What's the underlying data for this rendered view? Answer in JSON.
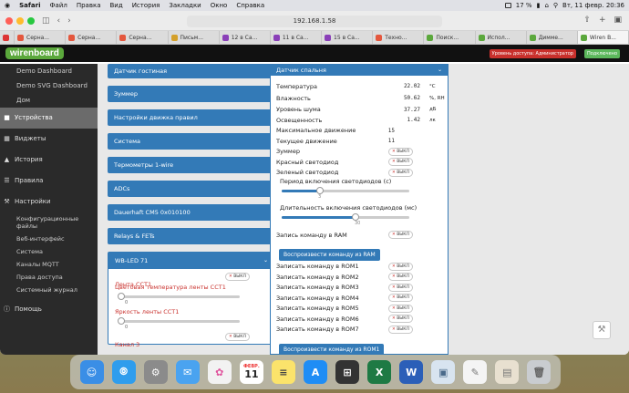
{
  "menubar": {
    "apple": "",
    "app": "Safari",
    "items": [
      "Файл",
      "Правка",
      "Вид",
      "История",
      "Закладки",
      "Окно",
      "Справка"
    ],
    "battery": "17 %",
    "datetime": "Вт, 11 февр. 20:36"
  },
  "browser": {
    "url": "192.168.1.58",
    "tabs": [
      "Серна...",
      "Серна...",
      "Серна...",
      "Письм...",
      "12 в Са...",
      "11 в Са...",
      "15 в Са...",
      "Техно...",
      "Поиск...",
      "Испол...",
      "Димме...",
      "Wiren B..."
    ]
  },
  "header": {
    "logo": "wirenboard",
    "access": "Уровень доступа: Администратор",
    "connected": "Подключено"
  },
  "sidebar": {
    "top_items": [
      "Demo Dashboard",
      "Demo SVG Dashboard",
      "Дом"
    ],
    "devices": "Устройства",
    "widgets": "Виджеты",
    "history": "История",
    "rules": "Правила",
    "settings": "Настройки",
    "settings_items": [
      "Конфигурационные файлы",
      "Веб-интерфейс",
      "Система",
      "Каналы MQTT",
      "Права доступа",
      "Системный журнал"
    ],
    "help": "Помощь"
  },
  "col1": {
    "panels": [
      "Датчик гостиная",
      "Зуммер",
      "Настройки движка правил",
      "Система",
      "Термометры 1-wire",
      "ADCs",
      "Dauerhaft CM5 0x010100",
      "Relays & FETs"
    ],
    "open_panel": {
      "title": "WB-LED 71",
      "items": [
        {
          "type": "switch",
          "label": "Лента CCT1",
          "value": "ВЫКЛ"
        },
        {
          "type": "slider",
          "label": "Цветовая температура ленты CCT1",
          "value": "0",
          "fraction": 0
        },
        {
          "type": "slider",
          "label": "Яркость ленты CCT1",
          "value": "0",
          "fraction": 0
        },
        {
          "type": "switch",
          "label": "Канал 3",
          "value": "ВЫКЛ"
        }
      ]
    }
  },
  "col2": {
    "title": "Датчик спальня",
    "readings": [
      {
        "name": "Температура",
        "value": "22.02",
        "unit": "°C"
      },
      {
        "name": "Влажность",
        "value": "50.62",
        "unit": "%, RH"
      },
      {
        "name": "Уровень шума",
        "value": "37.27",
        "unit": "дБ"
      },
      {
        "name": "Освещенность",
        "value": "1.42",
        "unit": "лк"
      },
      {
        "name": "Максимальное движение",
        "value": "15",
        "unit": ""
      },
      {
        "name": "Текущее движение",
        "value": "11",
        "unit": ""
      }
    ],
    "switches": [
      {
        "name": "Зуммер",
        "value": "ВЫКЛ"
      },
      {
        "name": "Красный светодиод",
        "value": "ВЫКЛ"
      },
      {
        "name": "Зеленый светодиод",
        "value": "ВЫКЛ"
      }
    ],
    "led_period": {
      "label": "Период включения светодиодов (с)",
      "value": "3",
      "fraction": 0.3
    },
    "led_duration": {
      "label": "Длительность включения светодиодов (мс)",
      "value": "30",
      "fraction": 0.58
    },
    "ram": {
      "label": "Запись команду в RAM",
      "value": "ВЫКЛ",
      "button": "Воспроизвести команду из RAM"
    },
    "rom": [
      {
        "name": "Записать команду в ROM1",
        "value": "ВЫКЛ"
      },
      {
        "name": "Записать команду в ROM2",
        "value": "ВЫКЛ"
      },
      {
        "name": "Записать команду в ROM3",
        "value": "ВЫКЛ"
      },
      {
        "name": "Записать команду в ROM4",
        "value": "ВЫКЛ"
      },
      {
        "name": "Записать команду в ROM5",
        "value": "ВЫКЛ"
      },
      {
        "name": "Записать команду в ROM6",
        "value": "ВЫКЛ"
      },
      {
        "name": "Записать команду в ROM7",
        "value": "ВЫКЛ"
      }
    ],
    "rom_button": "Воспроизвести команду из ROM1"
  },
  "dock": {
    "calendar_month": "ФЕВР.",
    "calendar_day": "11",
    "apps": [
      "finder-icon",
      "safari-icon",
      "system-settings-icon",
      "mail-icon",
      "photos-icon",
      "calendar-icon",
      "notes-icon",
      "app-store-icon",
      "calculator-icon",
      "excel-icon",
      "word-icon",
      "preview-icon",
      "textedit-icon",
      "documents-icon",
      "trash-icon"
    ]
  }
}
